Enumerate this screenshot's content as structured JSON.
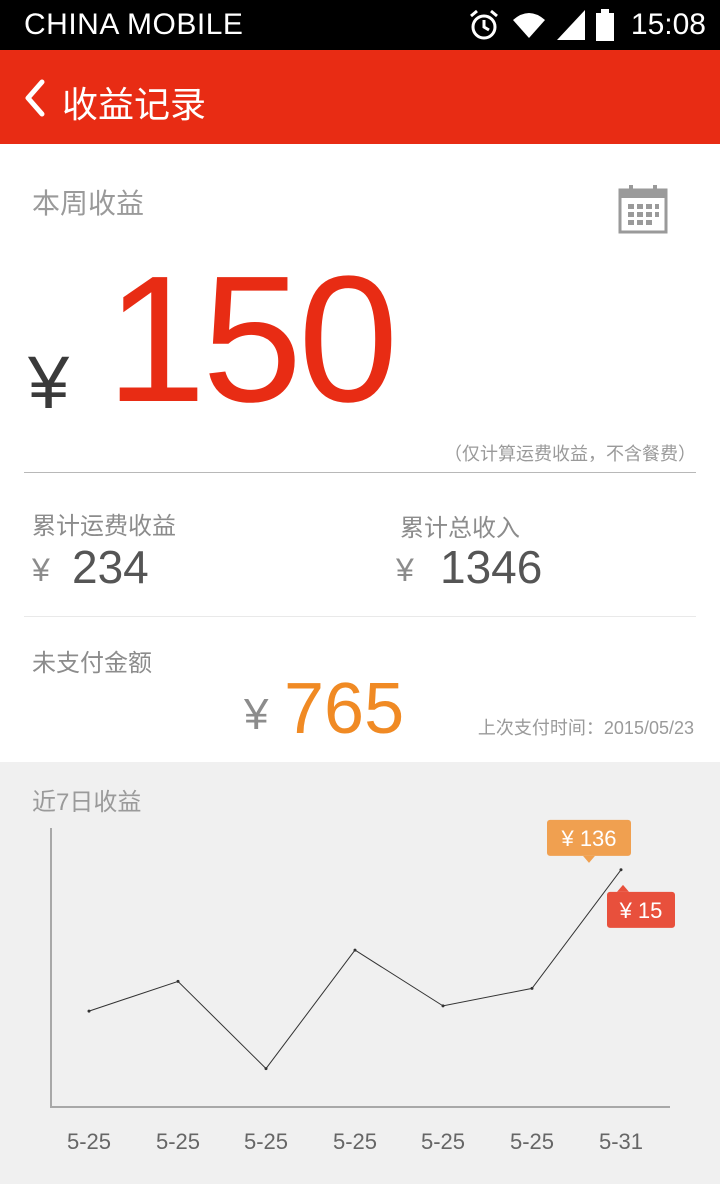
{
  "status_bar": {
    "carrier": "CHINA  MOBILE",
    "time": "15:08",
    "icons": [
      "alarm-icon",
      "wifi-icon",
      "signal-icon",
      "battery-icon"
    ]
  },
  "header": {
    "title": "收益记录",
    "background": "#e82c14"
  },
  "week": {
    "label": "本周收益",
    "currency": "¥",
    "amount": "150",
    "note": "（仅计算运费收益，不含餐费）",
    "accent": "#e82c14"
  },
  "cumulative": {
    "freight_label": "累计运费收益",
    "freight_currency": "¥",
    "freight_value": "234",
    "total_label": "累计总收入",
    "total_currency": "¥",
    "total_value": "1346"
  },
  "unpaid": {
    "label": "未支付金额",
    "currency": "¥",
    "value": "765",
    "last_payment": "上次支付时间：2015/05/23",
    "accent": "#f08a24"
  },
  "chart_data": {
    "type": "line",
    "title": "近7日收益",
    "categories": [
      "5-25",
      "5-25",
      "5-25",
      "5-25",
      "5-25",
      "5-25",
      "5-31"
    ],
    "series": [
      {
        "values": [
          55,
          72,
          22,
          90,
          58,
          68,
          136
        ]
      }
    ],
    "ylim": [
      0,
      160
    ],
    "grid": false,
    "tooltips": [
      {
        "text": "¥ 136",
        "color": "#f0a050"
      },
      {
        "text": "¥ 15",
        "color": "#e8503c"
      }
    ]
  }
}
